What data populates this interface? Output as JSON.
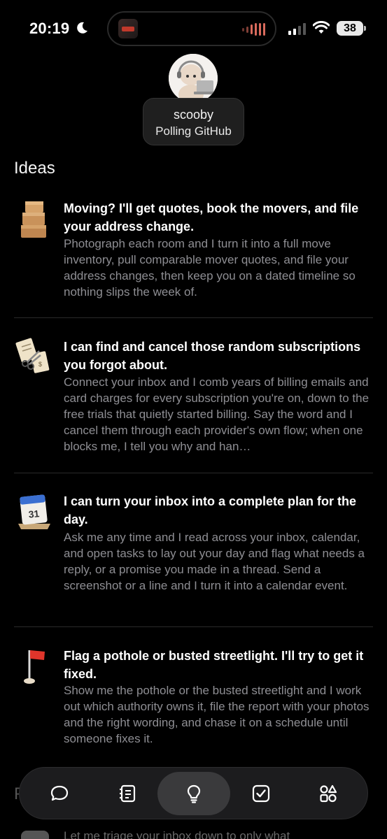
{
  "status_bar": {
    "time": "20:19",
    "battery": "38",
    "icons": [
      "moon-icon",
      "signal-icon",
      "wifi-icon",
      "battery-icon"
    ]
  },
  "agent": {
    "name": "scooby",
    "status": "Polling GitHub",
    "avatar_icon": "robot-avatar"
  },
  "section_title": "Ideas",
  "ideas": [
    {
      "icon": "moving-boxes-icon",
      "title": "Moving? I'll get quotes, book the movers, and file your address change.",
      "description": "Photograph each room and I turn it into a full move inventory, pull comparable mover quotes, and file your address changes, then keep you on a dated timeline so nothing slips the week of."
    },
    {
      "icon": "scissors-bills-icon",
      "title": "I can find and cancel those random subscriptions you forgot about.",
      "description": "Connect your inbox and I comb years of billing emails and card charges for every subscription you're on, down to the free trials that quietly started billing. Say the word and I cancel them through each provider's own flow; when one blocks me, I tell you why and han…"
    },
    {
      "icon": "calendar-icon",
      "calendar_day": "31",
      "title": "I can turn your inbox into a complete plan for the day.",
      "description": "Ask me any time and I read across your inbox, calendar, and open tasks to lay out your day and flag what needs a reply, or a promise you made in a thread. Send a screenshot or a line and I turn it into a calendar event."
    },
    {
      "icon": "red-flag-icon",
      "title": "Flag a pothole or busted streetlight. I'll try to get it fixed.",
      "description": "Show me the pothole or the busted streetlight and I work out which authority owns it, file the report with your photos and the right wording, and chase it on a schedule until someone fixes it."
    }
  ],
  "peek": {
    "letter": "P",
    "text": "Let me triage your inbox down to only what"
  },
  "tabbar": {
    "active": "ideas",
    "tabs": [
      {
        "name": "chat",
        "icon": "chat-bubble-icon"
      },
      {
        "name": "notes",
        "icon": "notebook-icon"
      },
      {
        "name": "ideas",
        "icon": "lightbulb-icon"
      },
      {
        "name": "tasks",
        "icon": "checkbox-icon"
      },
      {
        "name": "apps",
        "icon": "shapes-grid-icon"
      }
    ]
  },
  "colors": {
    "background": "#000000",
    "secondary_text": "#8e8e93",
    "tabbar": "#1c1c1e",
    "active_tab": "#3a3a3c",
    "flag_red": "#e0352b"
  }
}
